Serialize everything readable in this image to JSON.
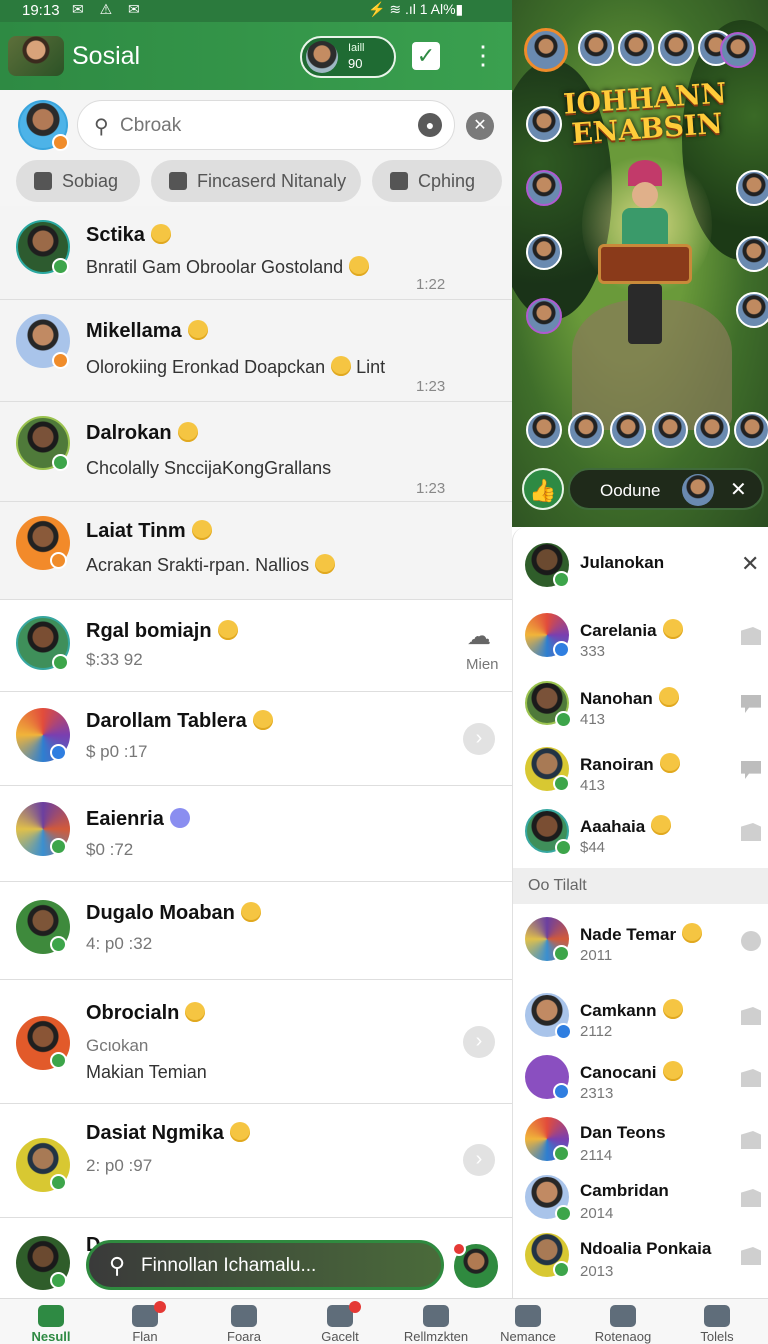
{
  "status_bar": {
    "time": "19:13",
    "left_icons": "✉ ⚠ ✉",
    "right_text": "⚡ ≋ .ıl 1 Al%▮"
  },
  "header": {
    "title": "Sosial",
    "profile_label": "Iaill",
    "profile_value": "90"
  },
  "search": {
    "placeholder": "Cbroak"
  },
  "chips": [
    {
      "label": "Sobiag"
    },
    {
      "label": "Fincaserd Nitanaly"
    },
    {
      "label": "Cphing"
    }
  ],
  "chats": [
    {
      "name": "Sctika",
      "preview": "Bnratil Gam Obroolar Gostoland",
      "time": "1:22"
    },
    {
      "name": "Mikellama",
      "preview": "Olorokiing Eronkad Doapckan",
      "preview_tail": "Lint",
      "time": "1:23"
    },
    {
      "name": "Dalrokan",
      "preview": "Chcolally SnccijaKongGrallans",
      "time": "1:23"
    },
    {
      "name": "Laiat Tinm",
      "preview": "Acrakan Srakti-rpan. Nallios"
    },
    {
      "name": "Rgal bomiajn",
      "sub": "$:33 92",
      "action_label": "Mien"
    },
    {
      "name": "Darollam Tablera",
      "sub": "$ p0 :17"
    },
    {
      "name": "Eaienria",
      "sub": "$0 :72"
    },
    {
      "name": "Dugalo Moaban",
      "sub": "4: p0 :32"
    },
    {
      "name": "Obrocialn",
      "sub": "Gcιokan",
      "sub2": "Makian Temian"
    },
    {
      "name": "Dasiat Ngmika",
      "sub": "2: p0 :97"
    },
    {
      "name": "D"
    }
  ],
  "floating_search": {
    "text": "Finnollan Ichamalu..."
  },
  "game": {
    "title_line1": "IOHHANN",
    "title_line2": "ENABSIN",
    "pill_text": "Oodune"
  },
  "friends": {
    "top": [
      {
        "name": "Julanokan",
        "sub": ""
      },
      {
        "name": "Carelania",
        "sub": "333"
      },
      {
        "name": "Nanohan",
        "sub": "413"
      },
      {
        "name": "Ranoiran",
        "sub": "413"
      },
      {
        "name": "Aaahaia",
        "sub": "$44"
      }
    ],
    "section_label": "Oo Tilalt",
    "rest": [
      {
        "name": "Nade Temar",
        "sub": "2011"
      },
      {
        "name": "Camkann",
        "sub": "2112"
      },
      {
        "name": "Canocani",
        "sub": "2313"
      },
      {
        "name": "Dan Teons",
        "sub": "2114"
      },
      {
        "name": "Cambridan",
        "sub": "2014"
      },
      {
        "name": "Ndoalia Ponkaia",
        "sub": "2013"
      }
    ]
  },
  "nav": [
    {
      "label": "Nesull",
      "active": true
    },
    {
      "label": "Flan"
    },
    {
      "label": "Foara"
    },
    {
      "label": "Gacelt"
    },
    {
      "label": "Rellmzkten"
    },
    {
      "label": "Nemance"
    },
    {
      "label": "Rotenaog"
    },
    {
      "label": "Tolels"
    }
  ],
  "colors": {
    "brand_green": "#2e8a43",
    "badge_green": "#3da54a",
    "badge_orange": "#f08c2a",
    "badge_blue": "#2f7ee0"
  }
}
